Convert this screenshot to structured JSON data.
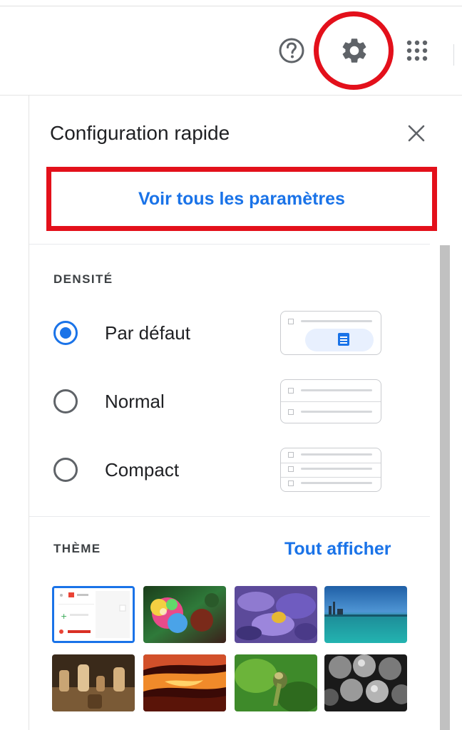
{
  "header": {
    "help_icon": "help-circle-icon",
    "settings_icon": "gear-icon",
    "apps_icon": "apps-grid-icon"
  },
  "quick_settings": {
    "title": "Configuration rapide",
    "close_icon": "close-icon",
    "all_settings_label": "Voir tous les paramètres",
    "density": {
      "label": "DENSITÉ",
      "options": [
        {
          "label": "Par défaut",
          "selected": true
        },
        {
          "label": "Normal",
          "selected": false
        },
        {
          "label": "Compact",
          "selected": false
        }
      ]
    },
    "theme": {
      "label": "THÈME",
      "view_all_label": "Tout afficher",
      "thumbnails": [
        {
          "name": "default-theme",
          "selected": true
        },
        {
          "name": "colorful-bubbles-theme",
          "selected": false
        },
        {
          "name": "purple-flowers-theme",
          "selected": false
        },
        {
          "name": "lake-city-theme",
          "selected": false
        },
        {
          "name": "chess-theme",
          "selected": false
        },
        {
          "name": "canyon-theme",
          "selected": false
        },
        {
          "name": "green-plant-theme",
          "selected": false
        },
        {
          "name": "bubbles-bw-theme",
          "selected": false
        }
      ]
    }
  },
  "colors": {
    "accent": "#1a73e8",
    "highlight": "#e3101b"
  }
}
